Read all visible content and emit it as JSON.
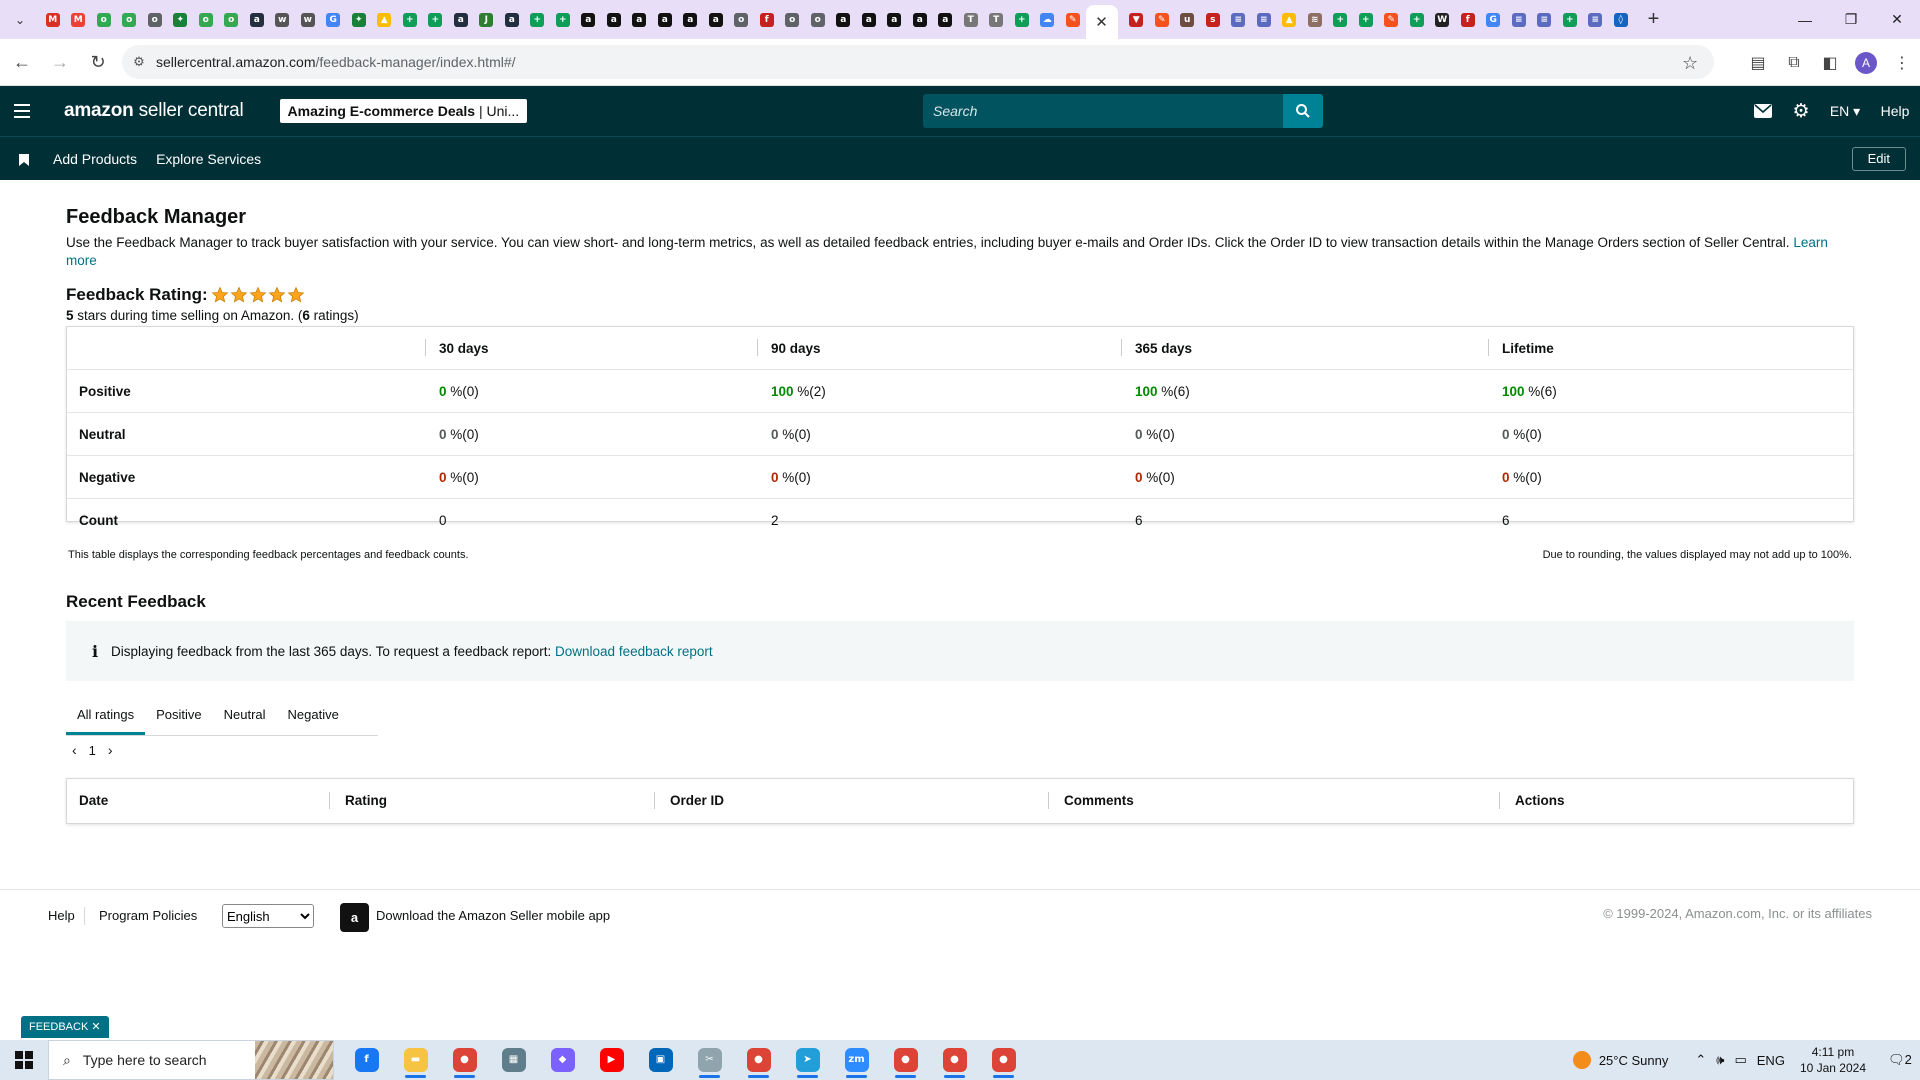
{
  "browser": {
    "favicons": [
      {
        "bg": "#d93025",
        "g": "M"
      },
      {
        "bg": "#ea4335",
        "g": "M"
      },
      {
        "bg": "#34a853",
        "g": "o"
      },
      {
        "bg": "#34a853",
        "g": "o"
      },
      {
        "bg": "#5f6368",
        "g": "o"
      },
      {
        "bg": "#188038",
        "g": "✦"
      },
      {
        "bg": "#34a853",
        "g": "o"
      },
      {
        "bg": "#34a853",
        "g": "o"
      },
      {
        "bg": "#232f3e",
        "g": "a"
      },
      {
        "bg": "#555555",
        "g": "w"
      },
      {
        "bg": "#555555",
        "g": "w"
      },
      {
        "bg": "#4285f4",
        "g": "G"
      },
      {
        "bg": "#188038",
        "g": "✦"
      },
      {
        "bg": "#fbbc04",
        "g": "▲"
      },
      {
        "bg": "#0f9d58",
        "g": "+"
      },
      {
        "bg": "#0f9d58",
        "g": "+"
      },
      {
        "bg": "#232f3e",
        "g": "a"
      },
      {
        "bg": "#2e7d32",
        "g": "J"
      },
      {
        "bg": "#232f3e",
        "g": "a"
      },
      {
        "bg": "#0f9d58",
        "g": "+"
      },
      {
        "bg": "#0f9d58",
        "g": "+"
      },
      {
        "bg": "#111111",
        "g": "a"
      },
      {
        "bg": "#111111",
        "g": "a"
      },
      {
        "bg": "#111111",
        "g": "a"
      },
      {
        "bg": "#111111",
        "g": "a"
      },
      {
        "bg": "#111111",
        "g": "a"
      },
      {
        "bg": "#111111",
        "g": "a"
      },
      {
        "bg": "#5f6368",
        "g": "o"
      },
      {
        "bg": "#c5221f",
        "g": "f"
      },
      {
        "bg": "#5f6368",
        "g": "o"
      },
      {
        "bg": "#5f6368",
        "g": "o"
      },
      {
        "bg": "#111111",
        "g": "a"
      },
      {
        "bg": "#111111",
        "g": "a"
      },
      {
        "bg": "#111111",
        "g": "a"
      },
      {
        "bg": "#111111",
        "g": "a"
      },
      {
        "bg": "#111111",
        "g": "a"
      },
      {
        "bg": "#777777",
        "g": "T"
      },
      {
        "bg": "#777777",
        "g": "T"
      },
      {
        "bg": "#0f9d58",
        "g": "+"
      },
      {
        "bg": "#4285f4",
        "g": "☁"
      },
      {
        "bg": "#f4511e",
        "g": "✎"
      }
    ],
    "active_tab_close": "✕",
    "favicons_right": [
      {
        "bg": "#c5221f",
        "g": "▼"
      },
      {
        "bg": "#f4511e",
        "g": "✎"
      },
      {
        "bg": "#6d4c41",
        "g": "u"
      },
      {
        "bg": "#c5221f",
        "g": "s"
      },
      {
        "bg": "#5c6bc0",
        "g": "≡"
      },
      {
        "bg": "#5c6bc0",
        "g": "≡"
      },
      {
        "bg": "#fbbc04",
        "g": "▲"
      },
      {
        "bg": "#8d6e63",
        "g": "≋"
      },
      {
        "bg": "#0f9d58",
        "g": "+"
      },
      {
        "bg": "#0f9d58",
        "g": "+"
      },
      {
        "bg": "#f4511e",
        "g": "✎"
      },
      {
        "bg": "#0f9d58",
        "g": "+"
      },
      {
        "bg": "#222222",
        "g": "W"
      },
      {
        "bg": "#c5221f",
        "g": "f"
      },
      {
        "bg": "#4285f4",
        "g": "G"
      },
      {
        "bg": "#5c6bc0",
        "g": "≡"
      },
      {
        "bg": "#5c6bc0",
        "g": "≡"
      },
      {
        "bg": "#0f9d58",
        "g": "+"
      },
      {
        "bg": "#5c6bc0",
        "g": "≡"
      },
      {
        "bg": "#1565c0",
        "g": "◊"
      }
    ],
    "new_tab": "+",
    "url_host": "sellercentral.amazon.com",
    "url_path": "/feedback-manager/index.html#/",
    "profile_initial": "A"
  },
  "header": {
    "logo_main": "amazon",
    "logo_rest": " seller central",
    "store_bold": "Amazing E-commerce Deals",
    "store_rest": " | Uni...",
    "search_placeholder": "Search",
    "lang": "EN",
    "help": "Help",
    "nav_links": [
      "Add Products",
      "Explore Services"
    ],
    "edit": "Edit"
  },
  "page": {
    "title": "Feedback Manager",
    "description": "Use the Feedback Manager to track buyer satisfaction with your service. You can view short- and long-term metrics, as well as detailed feedback entries, including buyer e-mails and Order IDs. Click the Order ID to view transaction details within the Manage Orders section of Seller Central.",
    "learn_more": "Learn more",
    "rating_label": "Feedback Rating:",
    "rating_stars": 5,
    "rating_sub_stars": "5",
    "rating_sub_text": " stars during time selling on Amazon. (",
    "rating_sub_count": "6",
    "rating_sub_end": " ratings)"
  },
  "metrics": {
    "columns": [
      "30 days",
      "90 days",
      "365 days",
      "Lifetime"
    ],
    "rows": [
      {
        "label": "Positive",
        "color": "green",
        "cells": [
          {
            "v": "0",
            "c": "(0)"
          },
          {
            "v": "100",
            "c": "(2)"
          },
          {
            "v": "100",
            "c": "(6)"
          },
          {
            "v": "100",
            "c": "(6)"
          }
        ]
      },
      {
        "label": "Neutral",
        "color": "grey",
        "cells": [
          {
            "v": "0",
            "c": "(0)"
          },
          {
            "v": "0",
            "c": "(0)"
          },
          {
            "v": "0",
            "c": "(0)"
          },
          {
            "v": "0",
            "c": "(0)"
          }
        ]
      },
      {
        "label": "Negative",
        "color": "red",
        "cells": [
          {
            "v": "0",
            "c": "(0)"
          },
          {
            "v": "0",
            "c": "(0)"
          },
          {
            "v": "0",
            "c": "(0)"
          },
          {
            "v": "0",
            "c": "(0)"
          }
        ]
      }
    ],
    "pct_sign": " %",
    "count_label": "Count",
    "counts": [
      "0",
      "2",
      "6",
      "6"
    ],
    "note_left": "This table displays the corresponding feedback percentages and feedback counts.",
    "note_right": "Due to rounding, the values displayed may not add up to 100%."
  },
  "recent": {
    "title": "Recent Feedback",
    "info_icon": "i",
    "info_text": "Displaying feedback from the last 365 days. To request a feedback report:",
    "info_link": "Download feedback report",
    "tabs": [
      "All ratings",
      "Positive",
      "Neutral",
      "Negative"
    ],
    "active_tab": 0,
    "page": "1",
    "table_headers": [
      "Date",
      "Rating",
      "Order ID",
      "Comments",
      "Actions"
    ]
  },
  "footer": {
    "help": "Help",
    "policies": "Program Policies",
    "language": "English",
    "app_text": "Download the Amazon Seller mobile app",
    "copyright": "© 1999-2024, Amazon.com, Inc. or its affiliates"
  },
  "feedback_badge": "FEEDBACK ✕",
  "taskbar": {
    "search_placeholder": "Type here to search",
    "apps": [
      {
        "bg": "#1877f2",
        "g": "f",
        "open": false
      },
      {
        "bg": "#f6c343",
        "g": "▬",
        "open": true
      },
      {
        "bg": "#db4437",
        "g": "●",
        "open": true
      },
      {
        "bg": "#607d8b",
        "g": "▦",
        "open": false
      },
      {
        "bg": "#7b61ff",
        "g": "◆",
        "open": false
      },
      {
        "bg": "#ff0000",
        "g": "▶",
        "open": false
      },
      {
        "bg": "#0067b8",
        "g": "▣",
        "open": false
      },
      {
        "bg": "#90a4ae",
        "g": "✂",
        "open": true
      },
      {
        "bg": "#db4437",
        "g": "●",
        "open": true
      },
      {
        "bg": "#229ed9",
        "g": "➤",
        "open": true
      },
      {
        "bg": "#2d8cff",
        "g": "zm",
        "open": true
      },
      {
        "bg": "#db4437",
        "g": "●",
        "open": true
      },
      {
        "bg": "#db4437",
        "g": "●",
        "open": true
      },
      {
        "bg": "#db4437",
        "g": "●",
        "open": true
      }
    ],
    "weather": "25°C  Sunny",
    "lang": "ENG",
    "time": "4:11 pm",
    "date": "10 Jan 2024",
    "notif_count": "2"
  },
  "colors": {
    "header_bg": "#002f36",
    "search_btn": "#008296",
    "link": "#007185",
    "positive": "#008a00",
    "negative": "#b12704",
    "star": "#ffa41c"
  }
}
